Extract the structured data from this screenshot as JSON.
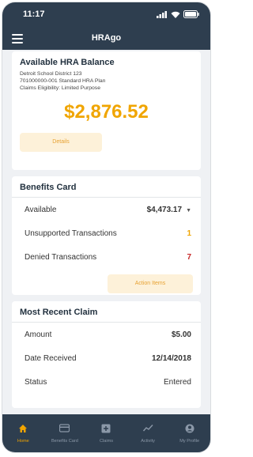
{
  "status_bar": {
    "time": "11:17"
  },
  "nav": {
    "title": "HRAgo"
  },
  "balance_card": {
    "title": "Available HRA Balance",
    "employer": "Detroit School District 123",
    "plan": "701000000-001 Standard HRA Plan",
    "eligibility": "Claims Eligibility: Limited Purpose",
    "amount": "$2,876.52",
    "details_label": "Details"
  },
  "benefits_card": {
    "title": "Benefits Card",
    "rows": [
      {
        "label": "Available",
        "value": "$4,473.17",
        "color": "#333333"
      },
      {
        "label": "Unsupported Transactions",
        "value": "1",
        "color": "#f0a500"
      },
      {
        "label": "Denied Transactions",
        "value": "7",
        "color": "#c62828"
      }
    ],
    "action_label": "Action Items"
  },
  "claim_card": {
    "title": "Most Recent Claim",
    "rows": [
      {
        "label": "Amount",
        "value": "$5.00"
      },
      {
        "label": "Date Received",
        "value": "12/14/2018"
      },
      {
        "label": "Status",
        "value": "Entered"
      }
    ]
  },
  "tabs": [
    {
      "label": "Home",
      "icon": "home-icon",
      "active": true
    },
    {
      "label": "Benefits Card",
      "icon": "card-icon",
      "active": false
    },
    {
      "label": "Claims",
      "icon": "add-claim-icon",
      "active": false
    },
    {
      "label": "Activity",
      "icon": "activity-icon",
      "active": false
    },
    {
      "label": "My Profile",
      "icon": "profile-icon",
      "active": false
    }
  ],
  "colors": {
    "header": "#2e3e4f",
    "accent": "#f0a500",
    "danger": "#c62828",
    "button_bg": "#fdf1d9"
  }
}
